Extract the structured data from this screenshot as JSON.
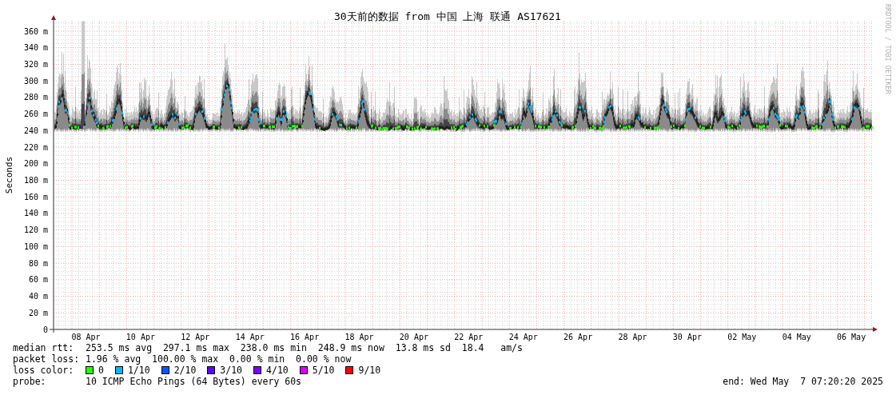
{
  "title": "30天前的数据 from 中国 上海 联通 AS17621",
  "credit": "RRDTOOL / TOBI OETIKER",
  "y_axis": {
    "label": "Seconds",
    "ticks": [
      "360 m",
      "340 m",
      "320 m",
      "300 m",
      "280 m",
      "260 m",
      "240 m",
      "220 m",
      "200 m",
      "180 m",
      "160 m",
      "140 m",
      "120 m",
      "100 m",
      "80 m",
      "60 m",
      "40 m",
      "20 m",
      "0"
    ]
  },
  "x_axis": {
    "ticks": [
      "08 Apr",
      "10 Apr",
      "12 Apr",
      "14 Apr",
      "16 Apr",
      "18 Apr",
      "20 Apr",
      "22 Apr",
      "24 Apr",
      "26 Apr",
      "28 Apr",
      "30 Apr",
      "02 May",
      "04 May",
      "06 May"
    ]
  },
  "median_rtt": {
    "label": "median rtt:",
    "text": "253.5 ms avg  297.1 ms max  238.0 ms min  248.9 ms now  13.8 ms sd  18.4   am/s"
  },
  "packet_loss": {
    "label": "packet loss:",
    "text": "1.96 % avg  100.00 % max  0.00 % min  0.00 % now"
  },
  "loss_color": {
    "label": "loss color:",
    "items": [
      {
        "label": "0",
        "color": "#26ff00"
      },
      {
        "label": "1/10",
        "color": "#00b8ff"
      },
      {
        "label": "2/10",
        "color": "#0059ff"
      },
      {
        "label": "3/10",
        "color": "#5e00ff"
      },
      {
        "label": "4/10",
        "color": "#7e00ff"
      },
      {
        "label": "5/10",
        "color": "#dd00ff"
      },
      {
        "label": "9/10",
        "color": "#ff0000"
      }
    ]
  },
  "probe": {
    "label": "probe:",
    "text": "10 ICMP Echo Pings (64 Bytes) every 60s",
    "end": "end: Wed May  7 07:20:20 2025"
  }
}
